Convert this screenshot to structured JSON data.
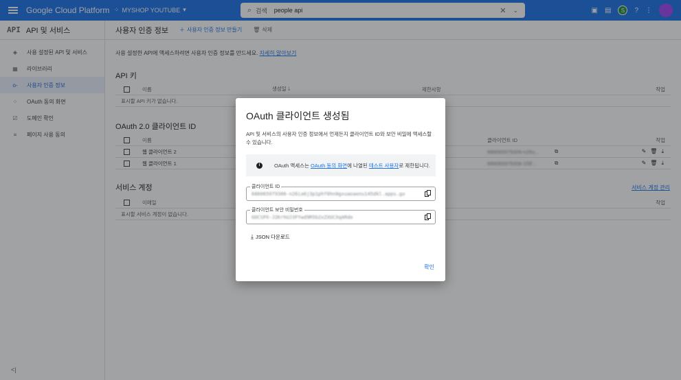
{
  "topbar": {
    "brand": "Google Cloud Platform",
    "project": "MYSHOP YOUTUBE",
    "search_label": "검색",
    "search_value": "people api",
    "profile_badge": "S"
  },
  "sidebar": {
    "api_mark": "API",
    "title": "API 및 서비스",
    "items": [
      {
        "label": "사용 설정된 API 및 서비스",
        "icon": "◈"
      },
      {
        "label": "라이브러리",
        "icon": "▦"
      },
      {
        "label": "사용자 인증 정보",
        "icon": "o-"
      },
      {
        "label": "OAuth 동의 화면",
        "icon": "⁘"
      },
      {
        "label": "도메인 확인",
        "icon": "☑"
      },
      {
        "label": "페이지 사용 동의",
        "icon": "≡"
      }
    ],
    "collapse_icon": "<|"
  },
  "main": {
    "title": "사용자 인증 정보",
    "create_label": "사용자 인증 정보 만들기",
    "delete_label": "삭제",
    "intro": "사용 설정한 API에 액세스하려면 사용자 인증 정보를 만드세요.",
    "intro_link": "자세히 알아보기",
    "api_keys": {
      "title": "API 키",
      "col_name": "이름",
      "col_created": "생성일",
      "col_restrictions": "제한사항",
      "col_actions": "작업",
      "empty": "표시할 API 키가 없습니다."
    },
    "oauth": {
      "title": "OAuth 2.0 클라이언트 ID",
      "col_name": "이름",
      "col_client_id": "클라이언트 ID",
      "col_actions": "작업",
      "rows": [
        {
          "name": "웹 클라이언트 2",
          "client_id": "686065979306-n26u..."
        },
        {
          "name": "웹 클라이언트 1",
          "client_id": "686065979306-1f3f..."
        }
      ]
    },
    "service_accounts": {
      "title": "서비스 계정",
      "manage_link": "서비스 계정 관리",
      "col_email": "이메일",
      "col_actions": "작업",
      "empty": "표시할 서비스 계정이 없습니다."
    }
  },
  "dialog": {
    "title": "OAuth 클라이언트 생성됨",
    "description": "API 및 서비스의 사용자 인증 정보에서 언제든지 클라이언트 ID와 보안 비밀에 액세스할 수 있습니다.",
    "notice_prefix": "OAuth 액세스는 ",
    "notice_link1": "OAuth 동의 화면",
    "notice_mid": "에 나열된 ",
    "notice_link2": "테스트 사용자",
    "notice_suffix": "로 제한됩니다.",
    "client_id_label": "클라이언트 ID",
    "client_id_value": "686065979306-n26ia6j3p1phf6hn0gxuaoaenu145dkl.apps.go",
    "client_secret_label": "클라이언트 보안 비밀번호",
    "client_secret_value": "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",
    "json_label": "JSON 다운로드",
    "confirm_label": "확인"
  }
}
